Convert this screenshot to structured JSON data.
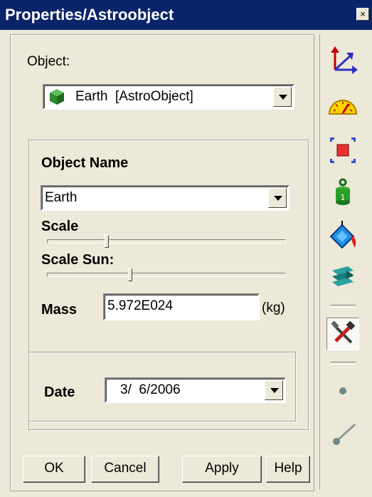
{
  "window": {
    "title": "Properties/Astroobject",
    "close_label": "×"
  },
  "object": {
    "label": "Object:",
    "selected": "Earth  [AstroObject]"
  },
  "fields": {
    "object_name_label": "Object Name",
    "object_name_value": "Earth",
    "scale_label": "Scale",
    "scale_value": 0.25,
    "scale_sun_label": "Scale Sun:",
    "scale_sun_value": 0.35,
    "mass_label": "Mass",
    "mass_value": "5.972E024",
    "mass_unit": "(kg)",
    "date_label": "Date",
    "date_value": "3/  6/2006"
  },
  "buttons": {
    "ok": "OK",
    "cancel": "Cancel",
    "apply": "Apply",
    "help": "Help"
  },
  "toolbar": [
    {
      "icon": "axes-icon"
    },
    {
      "icon": "speedometer-icon"
    },
    {
      "icon": "bounding-box-icon"
    },
    {
      "icon": "mass-weight-icon"
    },
    {
      "icon": "paint-bucket-icon"
    },
    {
      "icon": "layers-icon"
    },
    {
      "icon": "tools-icon",
      "active": true
    },
    {
      "icon": "point-icon",
      "disabled": true
    },
    {
      "icon": "line-icon",
      "disabled": true
    }
  ],
  "colors": {
    "title_bar": "#0a246a",
    "face": "#ece9d8"
  }
}
